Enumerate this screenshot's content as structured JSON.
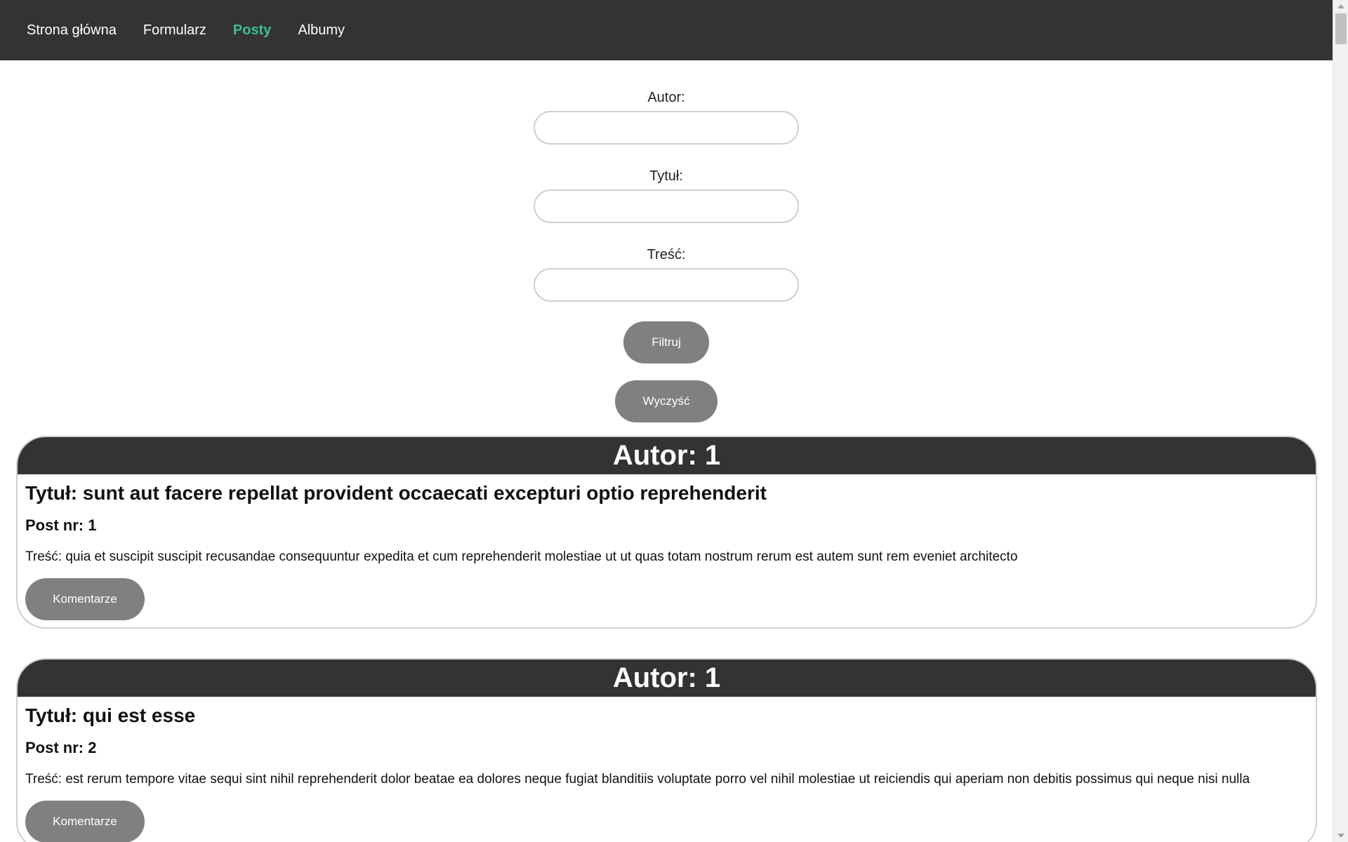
{
  "nav": {
    "items": [
      {
        "label": "Strona główna",
        "active": false
      },
      {
        "label": "Formularz",
        "active": false
      },
      {
        "label": "Posty",
        "active": true
      },
      {
        "label": "Albumy",
        "active": false
      }
    ],
    "active_color": "#3cc08e"
  },
  "filter": {
    "author_label": "Autor:",
    "author_value": "",
    "title_label": "Tytuł:",
    "title_value": "",
    "content_label": "Treść:",
    "content_value": "",
    "filter_button": "Filtruj",
    "clear_button": "Wyczyść"
  },
  "posts": [
    {
      "header": "Autor: 1",
      "title": "Tytuł: sunt aut facere repellat provident occaecati excepturi optio reprehenderit",
      "number": "Post nr: 1",
      "content": "Treść: quia et suscipit suscipit recusandae consequuntur expedita et cum reprehenderit molestiae ut ut quas totam nostrum rerum est autem sunt rem eveniet architecto",
      "comments_button": "Komentarze"
    },
    {
      "header": "Autor: 1",
      "title": "Tytuł: qui est esse",
      "number": "Post nr: 2",
      "content": "Treść: est rerum tempore vitae sequi sint nihil reprehenderit dolor beatae ea dolores neque fugiat blanditiis voluptate porro vel nihil molestiae ut reiciendis qui aperiam non debitis possimus qui neque nisi nulla",
      "comments_button": "Komentarze"
    }
  ],
  "colors": {
    "navbar_bg": "#333333",
    "button_bg": "#808080",
    "card_border": "#cfcfcf"
  }
}
